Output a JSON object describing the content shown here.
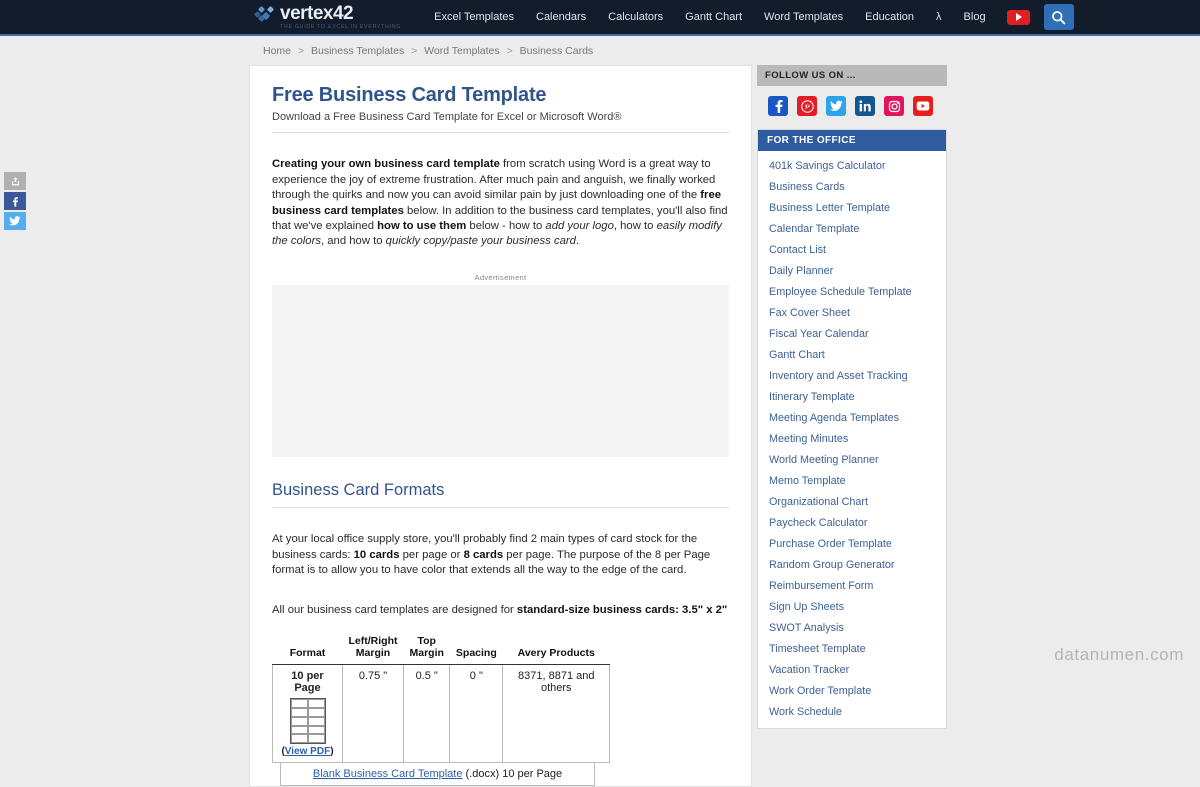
{
  "site": {
    "logo_word": "vertex42",
    "logo_tagline": "THE GUIDE TO EXCEL IN EVERYTHING",
    "watermark": "datanumen.com"
  },
  "nav": {
    "items": [
      {
        "label": "Excel Templates"
      },
      {
        "label": "Calendars"
      },
      {
        "label": "Calculators"
      },
      {
        "label": "Gantt Chart"
      },
      {
        "label": "Word Templates"
      },
      {
        "label": "Education"
      },
      {
        "label": "λ"
      },
      {
        "label": "Blog"
      }
    ],
    "youtube_icon": "youtube-icon",
    "search_icon": "search-icon"
  },
  "breadcrumb": {
    "items": [
      "Home",
      "Business Templates",
      "Word Templates",
      "Business Cards"
    ],
    "separator": ">"
  },
  "article": {
    "title": "Free Business Card Template",
    "subtitle": "Download a Free Business Card Template for Excel or Microsoft Word®",
    "intro": {
      "lead_bold": "Creating your own business card template",
      "part1": " from scratch using Word is a great way to experience the joy of extreme frustration. After much pain and anguish, we finally worked through the quirks and now you can avoid similar pain by just downloading one of the ",
      "bold2": "free business card templates",
      "part2": " below. In addition to the business card templates, you'll also find that we've explained ",
      "bold3": "how to use them",
      "part3": " below - how to ",
      "ital1": "add your logo",
      "part4": ", how to ",
      "ital2": "easily modify the colors",
      "part5": ", and how to ",
      "ital3": "quickly copy/paste your business card",
      "part6": "."
    },
    "ad_label": "Advertisement",
    "section_title": "Business Card Formats",
    "formats_p1": {
      "part1": "At your local office supply store, you'll probably find 2 main types of card stock for the business cards: ",
      "bold1": "10 cards",
      "part2": " per page or ",
      "bold2": "8 cards",
      "part3": " per page. The purpose of the 8 per Page format is to allow you to have color that extends all the way to the edge of the card."
    },
    "formats_p2": {
      "part1": "All our business card templates are designed for ",
      "bold1": "standard-size business cards: 3.5\" x 2\""
    }
  },
  "table": {
    "headers": [
      "Format",
      "Left/Right Margin",
      "Top Margin",
      "Spacing",
      "Avery Products"
    ],
    "rows": [
      {
        "format": "10 per Page",
        "view_pdf_prefix": "(",
        "view_pdf": "View PDF",
        "view_pdf_suffix": ")",
        "left_right_margin": "0.75 \"",
        "top_margin": "0.5 \"",
        "spacing": "0 \"",
        "avery": "8371, 8871 and others"
      }
    ],
    "download_row": {
      "link": "Blank Business Card Template",
      "suffix": " (.docx) 10 per Page"
    }
  },
  "sidebar": {
    "follow_header": "FOLLOW US ON ...",
    "social": [
      {
        "name": "facebook-icon",
        "color": "#1a56c4"
      },
      {
        "name": "pinterest-icon",
        "color": "#e31c26"
      },
      {
        "name": "twitter-icon",
        "color": "#2da3e8"
      },
      {
        "name": "linkedin-icon",
        "color": "#14568f"
      },
      {
        "name": "instagram-icon",
        "color": "#e0155e"
      },
      {
        "name": "youtube-icon",
        "color": "#e81d1d"
      }
    ],
    "office_header": "FOR THE OFFICE",
    "office_links": [
      "401k Savings Calculator",
      "Business Cards",
      "Business Letter Template",
      "Calendar Template",
      "Contact List",
      "Daily Planner",
      "Employee Schedule Template",
      "Fax Cover Sheet",
      "Fiscal Year Calendar",
      "Gantt Chart",
      "Inventory and Asset Tracking",
      "Itinerary Template",
      "Meeting Agenda Templates",
      "Meeting Minutes",
      "World Meeting Planner",
      "Memo Template",
      "Organizational Chart",
      "Paycheck Calculator",
      "Purchase Order Template",
      "Random Group Generator",
      "Reimbursement Form",
      "Sign Up Sheets",
      "SWOT Analysis",
      "Timesheet Template",
      "Vacation Tracker",
      "Work Order Template",
      "Work Schedule"
    ]
  },
  "share_rail": [
    {
      "name": "share-icon",
      "color": "#b0b0b0"
    },
    {
      "name": "facebook-share-icon",
      "color": "#3b5998"
    },
    {
      "name": "twitter-share-icon",
      "color": "#55acee"
    }
  ],
  "colors": {
    "nav_bg": "#121c2b",
    "accent_blue": "#2f5ca0",
    "heading_blue": "#31548c",
    "page_bg": "#ececec"
  }
}
